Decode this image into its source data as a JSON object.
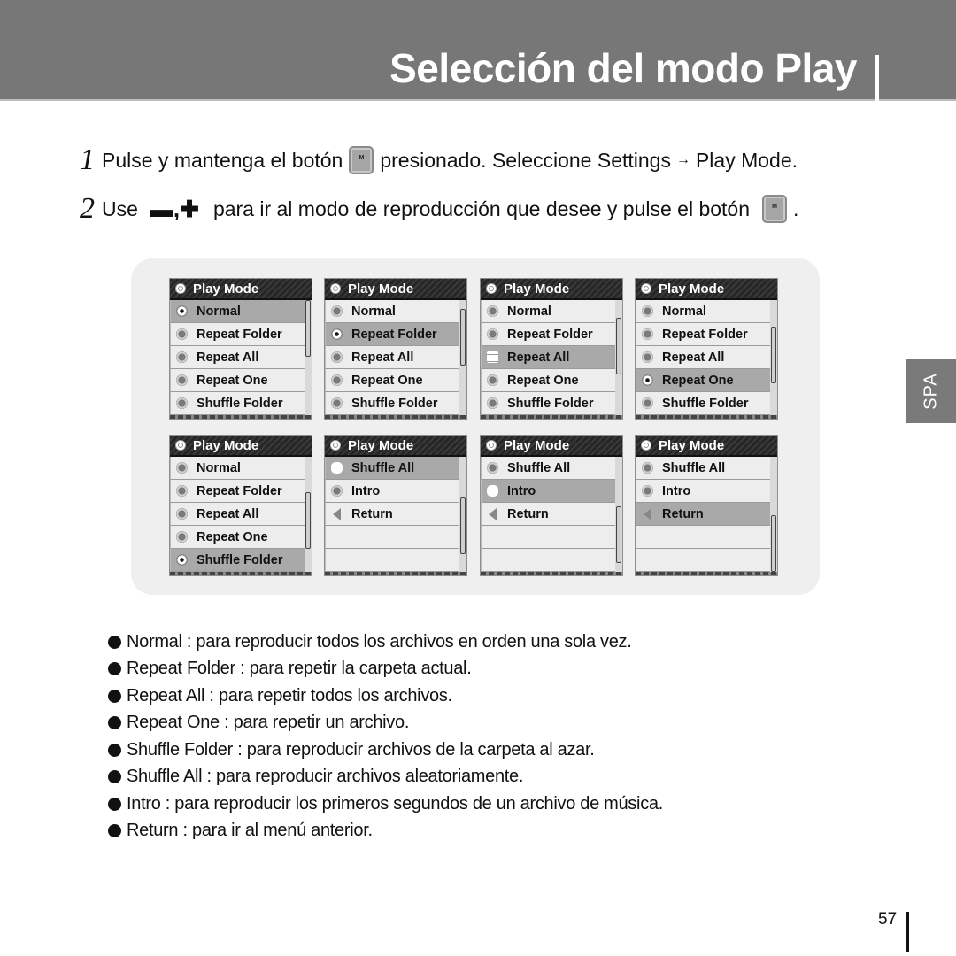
{
  "header": {
    "title": "Selección del modo Play"
  },
  "steps": [
    {
      "number": "1",
      "before": "Pulse y mantenga el botón",
      "button_label": "M",
      "after_1": "presionado. Seleccione Settings",
      "arrow": "→",
      "after_2": "Play Mode."
    },
    {
      "number": "2",
      "use": "Use",
      "minus": "▬",
      "comma": ",",
      "plus": "✚",
      "middle": "para ir al modo de reproducción que desee y pulse el botón",
      "button_label": "M",
      "end": "."
    }
  ],
  "screens": [
    {
      "title": "Play Mode",
      "rows": [
        {
          "label": "Normal",
          "icon": "radio-on",
          "selected": true
        },
        {
          "label": "Repeat Folder",
          "icon": "radio-off"
        },
        {
          "label": "Repeat All",
          "icon": "radio-off"
        },
        {
          "label": "Repeat One",
          "icon": "radio-off"
        },
        {
          "label": "Shuffle Folder",
          "icon": "radio-off"
        }
      ],
      "scroll_position": 0.0
    },
    {
      "title": "Play Mode",
      "rows": [
        {
          "label": "Normal",
          "icon": "radio-off"
        },
        {
          "label": "Repeat Folder",
          "icon": "radio-on",
          "selected": true
        },
        {
          "label": "Repeat All",
          "icon": "radio-off"
        },
        {
          "label": "Repeat One",
          "icon": "radio-off"
        },
        {
          "label": "Shuffle Folder",
          "icon": "radio-off"
        }
      ],
      "scroll_position": 0.15
    },
    {
      "title": "Play Mode",
      "rows": [
        {
          "label": "Normal",
          "icon": "radio-off"
        },
        {
          "label": "Repeat Folder",
          "icon": "radio-off"
        },
        {
          "label": "Repeat All",
          "icon": "stack",
          "selected": true
        },
        {
          "label": "Repeat One",
          "icon": "radio-off"
        },
        {
          "label": "Shuffle Folder",
          "icon": "radio-off"
        }
      ],
      "scroll_position": 0.3
    },
    {
      "title": "Play Mode",
      "rows": [
        {
          "label": "Normal",
          "icon": "radio-off"
        },
        {
          "label": "Repeat Folder",
          "icon": "radio-off"
        },
        {
          "label": "Repeat All",
          "icon": "radio-off"
        },
        {
          "label": "Repeat One",
          "icon": "radio-on",
          "selected": true
        },
        {
          "label": "Shuffle Folder",
          "icon": "radio-off"
        }
      ],
      "scroll_position": 0.45
    },
    {
      "title": "Play Mode",
      "rows": [
        {
          "label": "Normal",
          "icon": "radio-off"
        },
        {
          "label": "Repeat Folder",
          "icon": "radio-off"
        },
        {
          "label": "Repeat All",
          "icon": "radio-off"
        },
        {
          "label": "Repeat One",
          "icon": "radio-off"
        },
        {
          "label": "Shuffle Folder",
          "icon": "radio-on",
          "selected": true
        }
      ],
      "scroll_position": 0.6
    },
    {
      "title": "Play Mode",
      "rows": [
        {
          "label": "Shuffle All",
          "icon": "blank",
          "selected": true
        },
        {
          "label": "Intro",
          "icon": "radio-off"
        },
        {
          "label": "Return",
          "icon": "back"
        },
        {
          "label": "",
          "icon": "none"
        },
        {
          "label": "",
          "icon": "none"
        }
      ],
      "scroll_position": 0.7
    },
    {
      "title": "Play Mode",
      "rows": [
        {
          "label": "Shuffle All",
          "icon": "radio-off"
        },
        {
          "label": "Intro",
          "icon": "blank",
          "selected": true
        },
        {
          "label": "Return",
          "icon": "back"
        },
        {
          "label": "",
          "icon": "none"
        },
        {
          "label": "",
          "icon": "none"
        }
      ],
      "scroll_position": 0.85
    },
    {
      "title": "Play Mode",
      "rows": [
        {
          "label": "Shuffle All",
          "icon": "radio-off"
        },
        {
          "label": "Intro",
          "icon": "radio-off"
        },
        {
          "label": "Return",
          "icon": "back",
          "selected": true
        },
        {
          "label": "",
          "icon": "none"
        },
        {
          "label": "",
          "icon": "none"
        }
      ],
      "scroll_position": 1.0
    }
  ],
  "side_tab": "SPA",
  "descriptions": [
    "Normal : para reproducir todos los archivos en orden una sola vez.",
    "Repeat Folder : para repetir la carpeta actual.",
    "Repeat All : para repetir todos los archivos.",
    "Repeat One : para repetir un archivo.",
    "Shuffle Folder : para reproducir archivos de la carpeta al azar.",
    "Shuffle All : para reproducir archivos aleatoriamente.",
    "Intro : para reproducir los primeros segundos de un archivo de música.",
    "Return : para ir al menú anterior."
  ],
  "page_number": "57",
  "colors": {
    "header_band": "#777777",
    "panel_bg": "#efefef",
    "row_selected": "#a9a9a9",
    "row_normal": "#ededed"
  }
}
